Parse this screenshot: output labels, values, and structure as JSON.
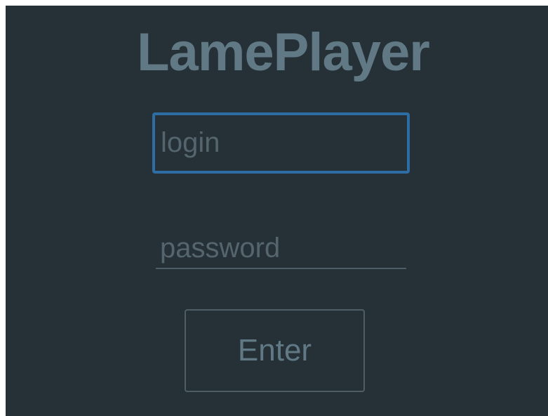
{
  "app": {
    "title": "LamePlayer"
  },
  "form": {
    "login_placeholder": "login",
    "login_value": "",
    "password_placeholder": "password",
    "password_value": "",
    "enter_label": "Enter"
  },
  "colors": {
    "background": "#263037",
    "title": "#607985",
    "focus_border": "#2e6da4",
    "placeholder": "#55656d",
    "border": "#4f5e66"
  }
}
